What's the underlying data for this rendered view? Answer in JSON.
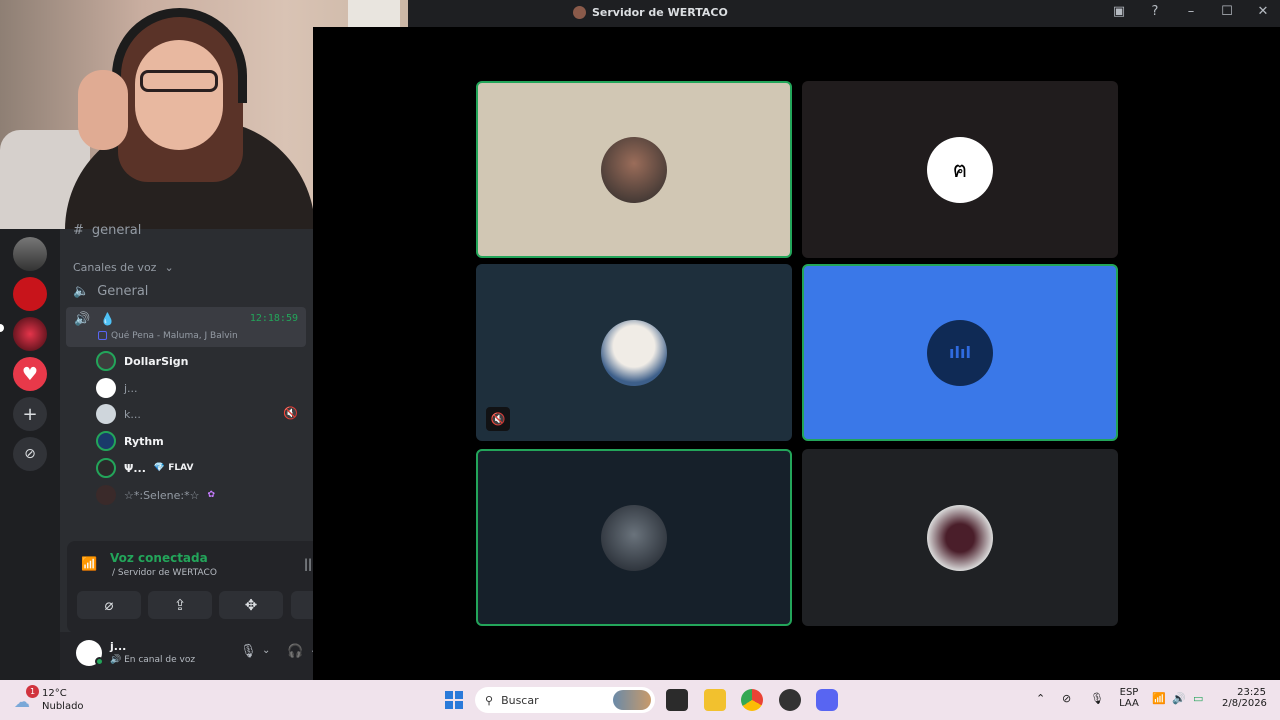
{
  "window": {
    "title": "Servidor de WERTACO"
  },
  "channels": {
    "text_channel": "general",
    "voice_category": "Canales de voz",
    "voice_channel": "General",
    "active_timer": "12:18:59",
    "activity": "Qué Pena - Maluma, J Balvin",
    "users": [
      {
        "name": "DollarSign",
        "badge": ""
      },
      {
        "name": "j...",
        "badge": ""
      },
      {
        "name": "k...",
        "badge": ""
      },
      {
        "name": "Rythm",
        "badge": ""
      },
      {
        "name": "Ψ...",
        "badge": "FLAV"
      },
      {
        "name": "☆*:Selene:*☆",
        "badge": ""
      }
    ]
  },
  "voice_panel": {
    "status": "Voz conectada",
    "server": "/ Servidor de WERTACO"
  },
  "user_bar": {
    "username": "j...",
    "status": "En canal de voz"
  },
  "taskbar": {
    "weather_temp": "12°C",
    "weather_desc": "Nublado",
    "weather_badge": "1",
    "search_placeholder": "Buscar",
    "lang_line1": "ESP",
    "lang_line2": "LAA",
    "time": "23:25",
    "date": "2/8/2026"
  },
  "colors": {
    "accent_green": "#23a55a",
    "speaking_blue": "#3a78e8",
    "discord_dark": "#2b2d31"
  }
}
